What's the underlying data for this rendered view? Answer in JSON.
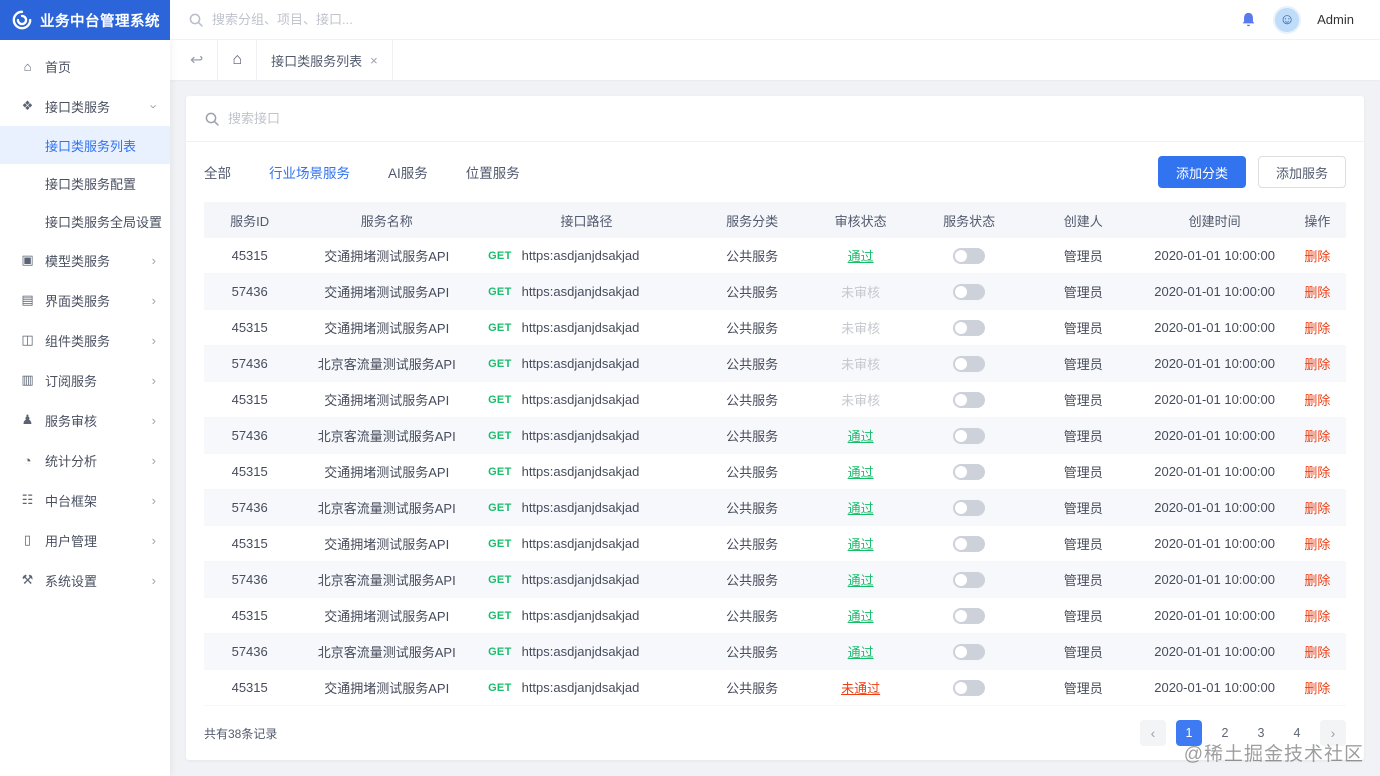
{
  "app": {
    "title": "业务中台管理系统",
    "topbar": {
      "search_placeholder": "搜索分组、项目、接口...",
      "user_name": "Admin"
    }
  },
  "sidebar": {
    "items": [
      {
        "label": "首页",
        "icon": "home",
        "glyph": "⌂",
        "type": "single"
      },
      {
        "label": "接口类服务",
        "icon": "api-service",
        "glyph": "❖",
        "type": "group",
        "expanded": true,
        "children": [
          {
            "label": "接口类服务列表",
            "active": true
          },
          {
            "label": "接口类服务配置",
            "active": false
          },
          {
            "label": "接口类服务全局设置",
            "active": false
          }
        ]
      },
      {
        "label": "模型类服务",
        "icon": "model-service",
        "glyph": "▣",
        "type": "group"
      },
      {
        "label": "界面类服务",
        "icon": "ui-service",
        "glyph": "▤",
        "type": "group"
      },
      {
        "label": "组件类服务",
        "icon": "component-service",
        "glyph": "◫",
        "type": "group"
      },
      {
        "label": "订阅服务",
        "icon": "subscription",
        "glyph": "▥",
        "type": "group"
      },
      {
        "label": "服务审核",
        "icon": "service-audit",
        "glyph": "♟",
        "type": "group"
      },
      {
        "label": "统计分析",
        "icon": "statistics",
        "glyph": "◔",
        "type": "group"
      },
      {
        "label": "中台框架",
        "icon": "framework",
        "glyph": "☷",
        "type": "group"
      },
      {
        "label": "用户管理",
        "icon": "user-management",
        "glyph": "▯",
        "type": "group"
      },
      {
        "label": "系统设置",
        "icon": "system-settings",
        "glyph": "⚒",
        "type": "group"
      }
    ]
  },
  "breadcrumb": {
    "tab_label": "接口类服务列表"
  },
  "panel": {
    "search_placeholder": "搜索接口",
    "tabs": [
      {
        "label": "全部",
        "active": false
      },
      {
        "label": "行业场景服务",
        "active": true
      },
      {
        "label": "AI服务",
        "active": false
      },
      {
        "label": "位置服务",
        "active": false
      }
    ],
    "add_category_label": "添加分类",
    "add_service_label": "添加服务"
  },
  "table": {
    "headers": [
      "服务ID",
      "服务名称",
      "接口路径",
      "服务分类",
      "审核状态",
      "服务状态",
      "创建人",
      "创建时间",
      "操作"
    ],
    "rows": [
      {
        "id": "45315",
        "name": "交通拥堵测试服务API",
        "method": "GET",
        "path": "https:asdjanjdsakjad",
        "category": "公共服务",
        "audit": "通过",
        "audit_state": "pass",
        "toggle_on": false,
        "creator": "管理员",
        "created": "2020-01-01 10:00:00",
        "action": "删除"
      },
      {
        "id": "57436",
        "name": "交通拥堵测试服务API",
        "method": "GET",
        "path": "https:asdjanjdsakjad",
        "category": "公共服务",
        "audit": "未审核",
        "audit_state": "pending",
        "toggle_on": false,
        "creator": "管理员",
        "created": "2020-01-01 10:00:00",
        "action": "删除"
      },
      {
        "id": "45315",
        "name": "交通拥堵测试服务API",
        "method": "GET",
        "path": "https:asdjanjdsakjad",
        "category": "公共服务",
        "audit": "未审核",
        "audit_state": "pending",
        "toggle_on": false,
        "creator": "管理员",
        "created": "2020-01-01 10:00:00",
        "action": "删除"
      },
      {
        "id": "57436",
        "name": "北京客流量测试服务API",
        "method": "GET",
        "path": "https:asdjanjdsakjad",
        "category": "公共服务",
        "audit": "未审核",
        "audit_state": "pending",
        "toggle_on": false,
        "creator": "管理员",
        "created": "2020-01-01 10:00:00",
        "action": "删除"
      },
      {
        "id": "45315",
        "name": "交通拥堵测试服务API",
        "method": "GET",
        "path": "https:asdjanjdsakjad",
        "category": "公共服务",
        "audit": "未审核",
        "audit_state": "pending",
        "toggle_on": false,
        "creator": "管理员",
        "created": "2020-01-01 10:00:00",
        "action": "删除"
      },
      {
        "id": "57436",
        "name": "北京客流量测试服务API",
        "method": "GET",
        "path": "https:asdjanjdsakjad",
        "category": "公共服务",
        "audit": "通过",
        "audit_state": "pass",
        "toggle_on": false,
        "creator": "管理员",
        "created": "2020-01-01 10:00:00",
        "action": "删除"
      },
      {
        "id": "45315",
        "name": "交通拥堵测试服务API",
        "method": "GET",
        "path": "https:asdjanjdsakjad",
        "category": "公共服务",
        "audit": "通过",
        "audit_state": "pass",
        "toggle_on": false,
        "creator": "管理员",
        "created": "2020-01-01 10:00:00",
        "action": "删除"
      },
      {
        "id": "57436",
        "name": "北京客流量测试服务API",
        "method": "GET",
        "path": "https:asdjanjdsakjad",
        "category": "公共服务",
        "audit": "通过",
        "audit_state": "pass",
        "toggle_on": false,
        "creator": "管理员",
        "created": "2020-01-01 10:00:00",
        "action": "删除"
      },
      {
        "id": "45315",
        "name": "交通拥堵测试服务API",
        "method": "GET",
        "path": "https:asdjanjdsakjad",
        "category": "公共服务",
        "audit": "通过",
        "audit_state": "pass",
        "toggle_on": false,
        "creator": "管理员",
        "created": "2020-01-01 10:00:00",
        "action": "删除"
      },
      {
        "id": "57436",
        "name": "北京客流量测试服务API",
        "method": "GET",
        "path": "https:asdjanjdsakjad",
        "category": "公共服务",
        "audit": "通过",
        "audit_state": "pass",
        "toggle_on": false,
        "creator": "管理员",
        "created": "2020-01-01 10:00:00",
        "action": "删除"
      },
      {
        "id": "45315",
        "name": "交通拥堵测试服务API",
        "method": "GET",
        "path": "https:asdjanjdsakjad",
        "category": "公共服务",
        "audit": "通过",
        "audit_state": "pass",
        "toggle_on": false,
        "creator": "管理员",
        "created": "2020-01-01 10:00:00",
        "action": "删除"
      },
      {
        "id": "57436",
        "name": "北京客流量测试服务API",
        "method": "GET",
        "path": "https:asdjanjdsakjad",
        "category": "公共服务",
        "audit": "通过",
        "audit_state": "pass",
        "toggle_on": false,
        "creator": "管理员",
        "created": "2020-01-01 10:00:00",
        "action": "删除"
      },
      {
        "id": "45315",
        "name": "交通拥堵测试服务API",
        "method": "GET",
        "path": "https:asdjanjdsakjad",
        "category": "公共服务",
        "audit": "未通过",
        "audit_state": "fail",
        "toggle_on": false,
        "creator": "管理员",
        "created": "2020-01-01 10:00:00",
        "action": "删除"
      }
    ]
  },
  "footer": {
    "total_label": "共有38条记录",
    "prev": "‹",
    "next": "›",
    "pages": [
      "1",
      "2",
      "3",
      "4"
    ],
    "active_page": "1"
  },
  "watermark": "@稀土掘金技术社区",
  "colors": {
    "brand": "#2b65d9",
    "primary": "#3273f0",
    "pagination_active": "#3e7bf2",
    "green": "#19be6b",
    "red": "#ed4014",
    "muted": "#c5c8ce",
    "stripe": "#f7f8fc"
  }
}
